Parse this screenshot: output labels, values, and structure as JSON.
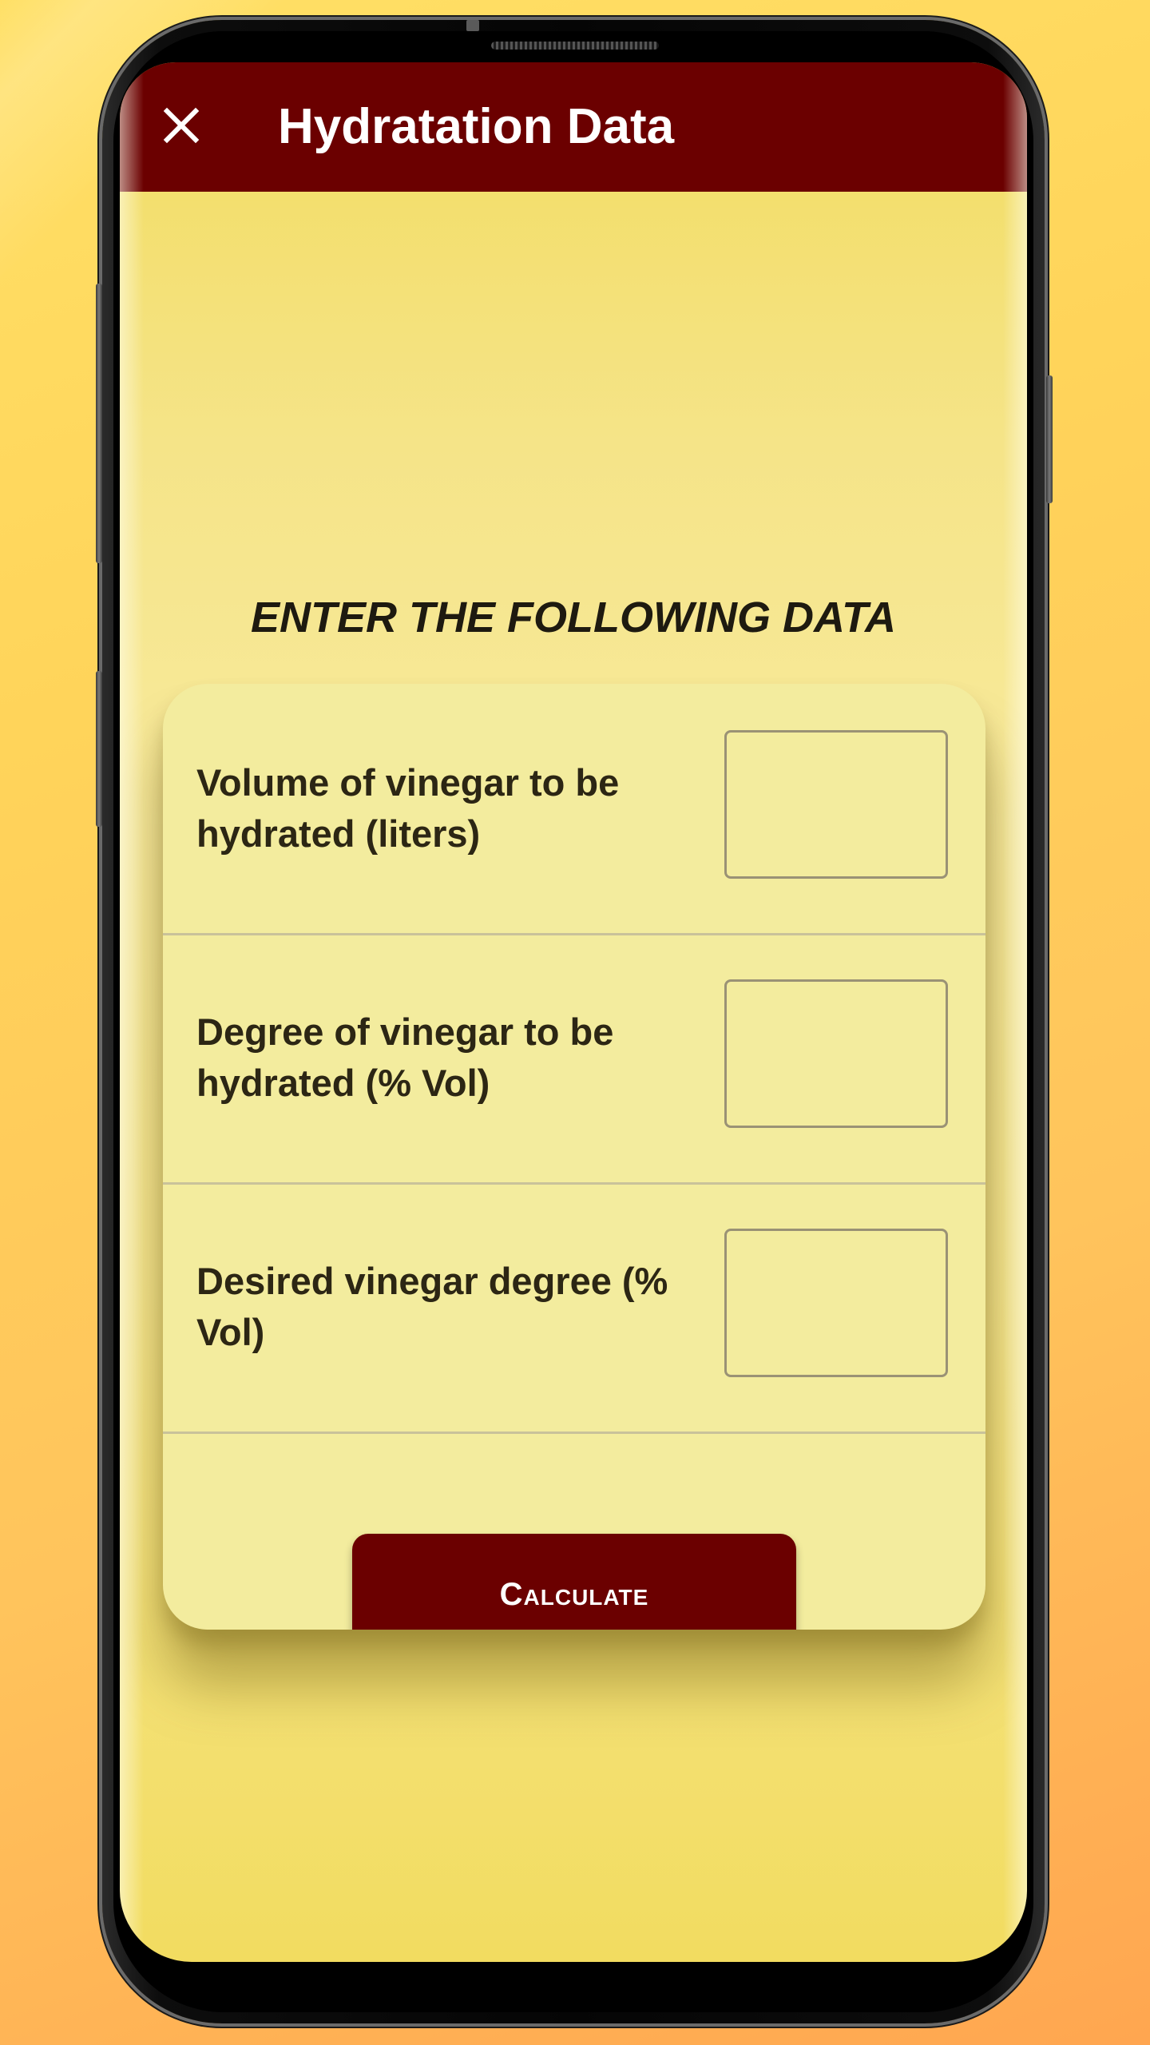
{
  "app_bar": {
    "title": "Hydratation Data",
    "close_icon": "close-icon",
    "background_color": "#6b0000"
  },
  "form": {
    "heading": "ENTER THE FOLLOWING DATA",
    "fields": [
      {
        "label": "Volume of vinegar to be hydrated (liters)",
        "value": ""
      },
      {
        "label": "Degree of vinegar to be hydrated (% Vol)",
        "value": ""
      },
      {
        "label": "Desired vinegar degree (% Vol)",
        "value": ""
      }
    ],
    "calculate_label": "Calculate"
  },
  "colors": {
    "accent": "#6b0000",
    "screen_background": "#f5e488",
    "card_background": "#f3ec9e"
  }
}
